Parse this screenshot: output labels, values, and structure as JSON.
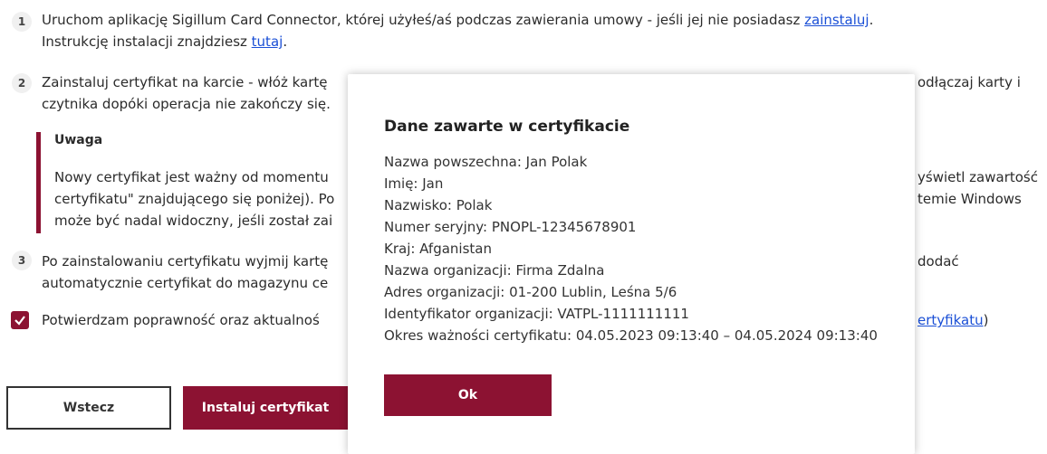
{
  "steps": [
    {
      "num": "1",
      "lines": [
        "Uruchom aplikację Sigillum Card Connector, której użyłeś/aś podczas zawierania umowy - jeśli jej nie posiadasz ",
        "Instrukcję instalacji znajdziesz "
      ],
      "link1": "zainstaluj",
      "link1_suffix": ".",
      "link2": "tutaj",
      "link2_suffix": "."
    },
    {
      "num": "2",
      "line1_left": "Zainstaluj certyfikat na karcie - włóż kartę",
      "line1_right": "odłączaj karty i",
      "line2": "czytnika dopóki operacja nie zakończy się."
    },
    {
      "num": "3",
      "line1_left": "Po zainstalowaniu certyfikatu wyjmij kartę",
      "line1_right": "dodać",
      "line2": "automatycznie certyfikat do magazynu ce"
    }
  ],
  "note": {
    "title": "Uwaga",
    "lines_left": [
      "Nowy certyfikat jest ważny od momentu",
      "certyfikatu\" znajdującego się poniżej). Po",
      "może być nadal widoczny, jeśli został zai"
    ],
    "lines_right": [
      "yświetl zawartość",
      "temie Windows"
    ]
  },
  "confirm": {
    "text_left": "Potwierdzam poprawność oraz aktualnoś",
    "link": "ertyfikatu",
    "suffix": ")"
  },
  "buttons": {
    "back": "Wstecz",
    "install": "Instaluj certyfikat"
  },
  "modal": {
    "title": "Dane zawarte w certyfikacie",
    "fields": [
      "Nazwa powszechna: Jan Polak",
      "Imię: Jan",
      "Nazwisko: Polak",
      "Numer seryjny: PNOPL-12345678901",
      "Kraj: Afganistan",
      "Nazwa organizacji: Firma Zdalna",
      "Adres organizacji: 01-200 Lublin, Leśna 5/6",
      "Identyfikator organizacji: VATPL-1111111111",
      "Okres ważności certyfikatu: 04.05.2023 09:13:40 – 04.05.2024 09:13:40"
    ],
    "ok": "Ok"
  },
  "colors": {
    "accent": "#8c1232",
    "link": "#1a4fd6"
  }
}
